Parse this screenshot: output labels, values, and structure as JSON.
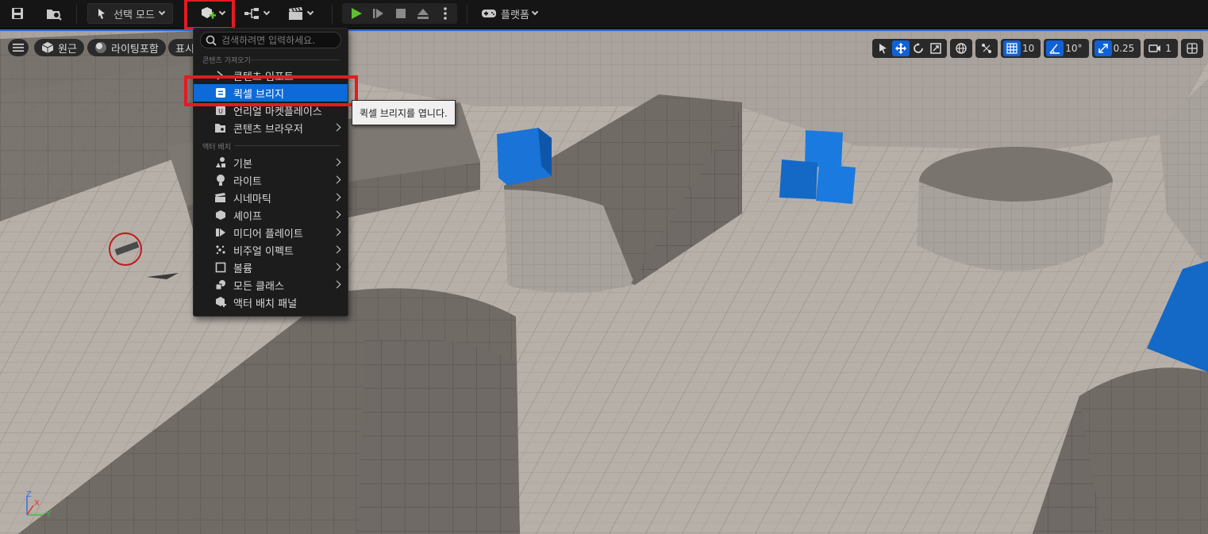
{
  "toolbar": {
    "save_icon": "save-icon",
    "browse_icon": "content-browse-icon",
    "mode_label": "선택 모드",
    "add_icon": "add-actor-icon",
    "blueprint_icon": "blueprint-icon",
    "cinematics_icon": "clapperboard-icon",
    "play_icon": "play-icon",
    "step_icon": "step-icon",
    "stop_icon": "stop-icon",
    "eject_icon": "eject-icon",
    "more_icon": "vertical-dots-icon",
    "platform_label": "플랫폼",
    "accent_color": "#e31b23"
  },
  "viewport": {
    "menu_icon": "hamburger-icon",
    "perspective_label": "원근",
    "lighting_label": "라이팅포함",
    "show_label": "표시",
    "grid_snap_value": "10",
    "rotation_snap_value": "10°",
    "scale_snap_value": "0.25",
    "camera_speed_value": "1",
    "axis_labels": {
      "z": "Z",
      "x": "X",
      "y": "Y"
    }
  },
  "menu": {
    "search_placeholder": "검색하려면 입력하세요.",
    "section_import": "콘텐츠 가져오기",
    "section_place": "액터 배치",
    "items": [
      {
        "label": "콘텐츠 임포트",
        "icon": "import-icon"
      },
      {
        "label": "퀵셀 브리지",
        "icon": "bridge-icon"
      },
      {
        "label": "언리얼 마켓플레이스",
        "icon": "marketplace-icon"
      },
      {
        "label": "콘텐츠 브라우저",
        "icon": "content-browser-icon"
      },
      {
        "label": "기본",
        "icon": "basic-shapes-icon"
      },
      {
        "label": "라이트",
        "icon": "light-bulb-icon"
      },
      {
        "label": "시네마틱",
        "icon": "clapperboard-icon"
      },
      {
        "label": "셰이프",
        "icon": "shape-icon"
      },
      {
        "label": "미디어 플레이트",
        "icon": "media-plate-icon"
      },
      {
        "label": "비주얼 이펙트",
        "icon": "visual-effects-icon"
      },
      {
        "label": "볼륨",
        "icon": "volume-icon"
      },
      {
        "label": "모든 클래스",
        "icon": "all-classes-icon"
      },
      {
        "label": "액터 배치 패널",
        "icon": "place-actors-icon"
      }
    ],
    "selected_color": "#0e6ad8"
  },
  "tooltip": {
    "text": "퀵셀 브리지를 엽니다."
  }
}
